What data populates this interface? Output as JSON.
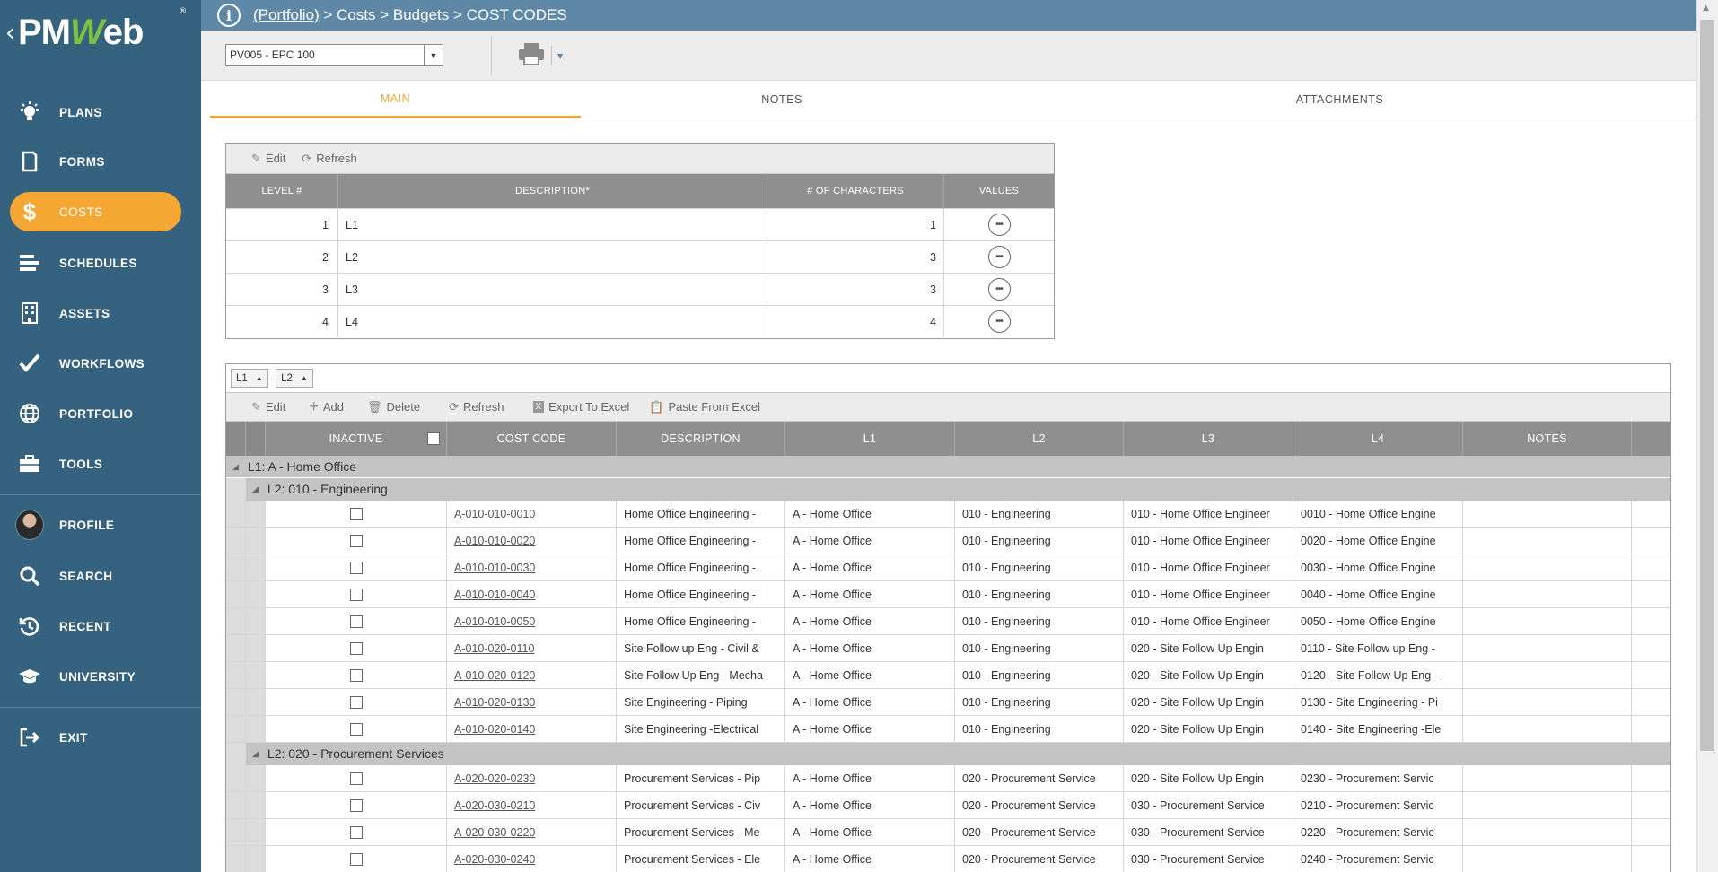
{
  "app": {
    "logo_text_pre": "PM",
    "logo_text_w": "W",
    "logo_text_post": "eb",
    "logo_reg": "®"
  },
  "sidebar": {
    "items": [
      {
        "label": "PLANS",
        "icon": "lightbulb-icon"
      },
      {
        "label": "FORMS",
        "icon": "document-icon"
      },
      {
        "label": "COSTS",
        "icon": "dollar-icon",
        "active": true
      },
      {
        "label": "SCHEDULES",
        "icon": "schedule-bars-icon"
      },
      {
        "label": "ASSETS",
        "icon": "building-icon"
      },
      {
        "label": "WORKFLOWS",
        "icon": "checkmark-icon"
      },
      {
        "label": "PORTFOLIO",
        "icon": "globe-icon"
      },
      {
        "label": "TOOLS",
        "icon": "briefcase-icon"
      },
      {
        "label": "PROFILE",
        "icon": "avatar"
      },
      {
        "label": "SEARCH",
        "icon": "search-icon"
      },
      {
        "label": "RECENT",
        "icon": "history-icon"
      },
      {
        "label": "UNIVERSITY",
        "icon": "graduation-cap-icon"
      },
      {
        "label": "EXIT",
        "icon": "exit-icon"
      }
    ],
    "accent_color": "#f5a733",
    "bg_color": "#34627f"
  },
  "breadcrumb": {
    "portfolio": "(Portfolio)",
    "rest": " > Costs > Budgets > COST CODES"
  },
  "toolbar": {
    "project_value": "PV005 - EPC 100"
  },
  "tabs": [
    {
      "label": "MAIN",
      "active": true
    },
    {
      "label": "NOTES"
    },
    {
      "label": "ATTACHMENTS"
    }
  ],
  "levels_grid": {
    "tools": {
      "edit": "Edit",
      "refresh": "Refresh"
    },
    "headers": {
      "level": "LEVEL #",
      "description": "DESCRIPTION*",
      "chars": "# OF CHARACTERS",
      "values": "VALUES"
    },
    "rows": [
      {
        "level": "1",
        "description": "L1",
        "chars": "1"
      },
      {
        "level": "2",
        "description": "L2",
        "chars": "3"
      },
      {
        "level": "3",
        "description": "L3",
        "chars": "3"
      },
      {
        "level": "4",
        "description": "L4",
        "chars": "4"
      }
    ]
  },
  "codes_grid": {
    "group_chips": [
      "L1",
      "L2"
    ],
    "group_sep": "-",
    "tools": {
      "edit": "Edit",
      "add": "Add",
      "delete": "Delete",
      "refresh": "Refresh",
      "export": "Export To Excel",
      "paste": "Paste From Excel"
    },
    "headers": {
      "inactive": "INACTIVE",
      "code": "COST CODE",
      "description": "DESCRIPTION",
      "l1": "L1",
      "l2": "L2",
      "l3": "L3",
      "l4": "L4",
      "notes": "NOTES"
    },
    "group_l1": "L1: A - Home Office",
    "group_l2a": "L2: 010 - Engineering",
    "group_l2b": "L2: 020 - Procurement Services",
    "rows_a": [
      {
        "code": "A-010-010-0010",
        "description": "Home Office Engineering -",
        "l1": "A - Home Office",
        "l2": "010 - Engineering",
        "l3": "010 - Home Office Engineer",
        "l4": "0010 - Home Office Engine"
      },
      {
        "code": "A-010-010-0020",
        "description": "Home Office Engineering -",
        "l1": "A - Home Office",
        "l2": "010 - Engineering",
        "l3": "010 - Home Office Engineer",
        "l4": "0020 - Home Office Engine"
      },
      {
        "code": "A-010-010-0030",
        "description": "Home Office Engineering -",
        "l1": "A - Home Office",
        "l2": "010 - Engineering",
        "l3": "010 - Home Office Engineer",
        "l4": "0030 - Home Office Engine"
      },
      {
        "code": "A-010-010-0040",
        "description": "Home Office Engineering -",
        "l1": "A - Home Office",
        "l2": "010 - Engineering",
        "l3": "010 - Home Office Engineer",
        "l4": "0040 - Home Office Engine"
      },
      {
        "code": "A-010-010-0050",
        "description": "Home Office Engineering -",
        "l1": "A - Home Office",
        "l2": "010 - Engineering",
        "l3": "010 - Home Office Engineer",
        "l4": "0050 - Home Office Engine"
      },
      {
        "code": "A-010-020-0110",
        "description": "Site Follow up Eng - Civil &",
        "l1": "A - Home Office",
        "l2": "010 - Engineering",
        "l3": "020 - Site Follow Up Engin",
        "l4": "0110 - Site Follow up Eng -"
      },
      {
        "code": "A-010-020-0120",
        "description": "Site Follow Up Eng - Mecha",
        "l1": "A - Home Office",
        "l2": "010 - Engineering",
        "l3": "020 - Site Follow Up Engin",
        "l4": "0120 - Site Follow Up Eng -"
      },
      {
        "code": "A-010-020-0130",
        "description": "Site Engineering - Piping",
        "l1": "A - Home Office",
        "l2": "010 - Engineering",
        "l3": "020 - Site Follow Up Engin",
        "l4": "0130 - Site Engineering - Pi"
      },
      {
        "code": "A-010-020-0140",
        "description": "Site Engineering -Electrical",
        "l1": "A - Home Office",
        "l2": "010 - Engineering",
        "l3": "020 - Site Follow Up Engin",
        "l4": "0140 - Site Engineering -Ele"
      }
    ],
    "rows_b": [
      {
        "code": "A-020-020-0230",
        "description": "Procurement Services - Pip",
        "l1": "A - Home Office",
        "l2": "020 - Procurement Service",
        "l3": "020 - Site Follow Up Engin",
        "l4": "0230 - Procurement Servic"
      },
      {
        "code": "A-020-030-0210",
        "description": "Procurement Services - Civ",
        "l1": "A - Home Office",
        "l2": "020 - Procurement Service",
        "l3": "030 - Procurement Service",
        "l4": "0210 - Procurement Servic"
      },
      {
        "code": "A-020-030-0220",
        "description": "Procurement Services - Me",
        "l1": "A - Home Office",
        "l2": "020 - Procurement Service",
        "l3": "030 - Procurement Service",
        "l4": "0220 - Procurement Servic"
      },
      {
        "code": "A-020-030-0240",
        "description": "Procurement Services - Ele",
        "l1": "A - Home Office",
        "l2": "020 - Procurement Service",
        "l3": "030 - Procurement Service",
        "l4": "0240 - Procurement Servic"
      }
    ]
  }
}
